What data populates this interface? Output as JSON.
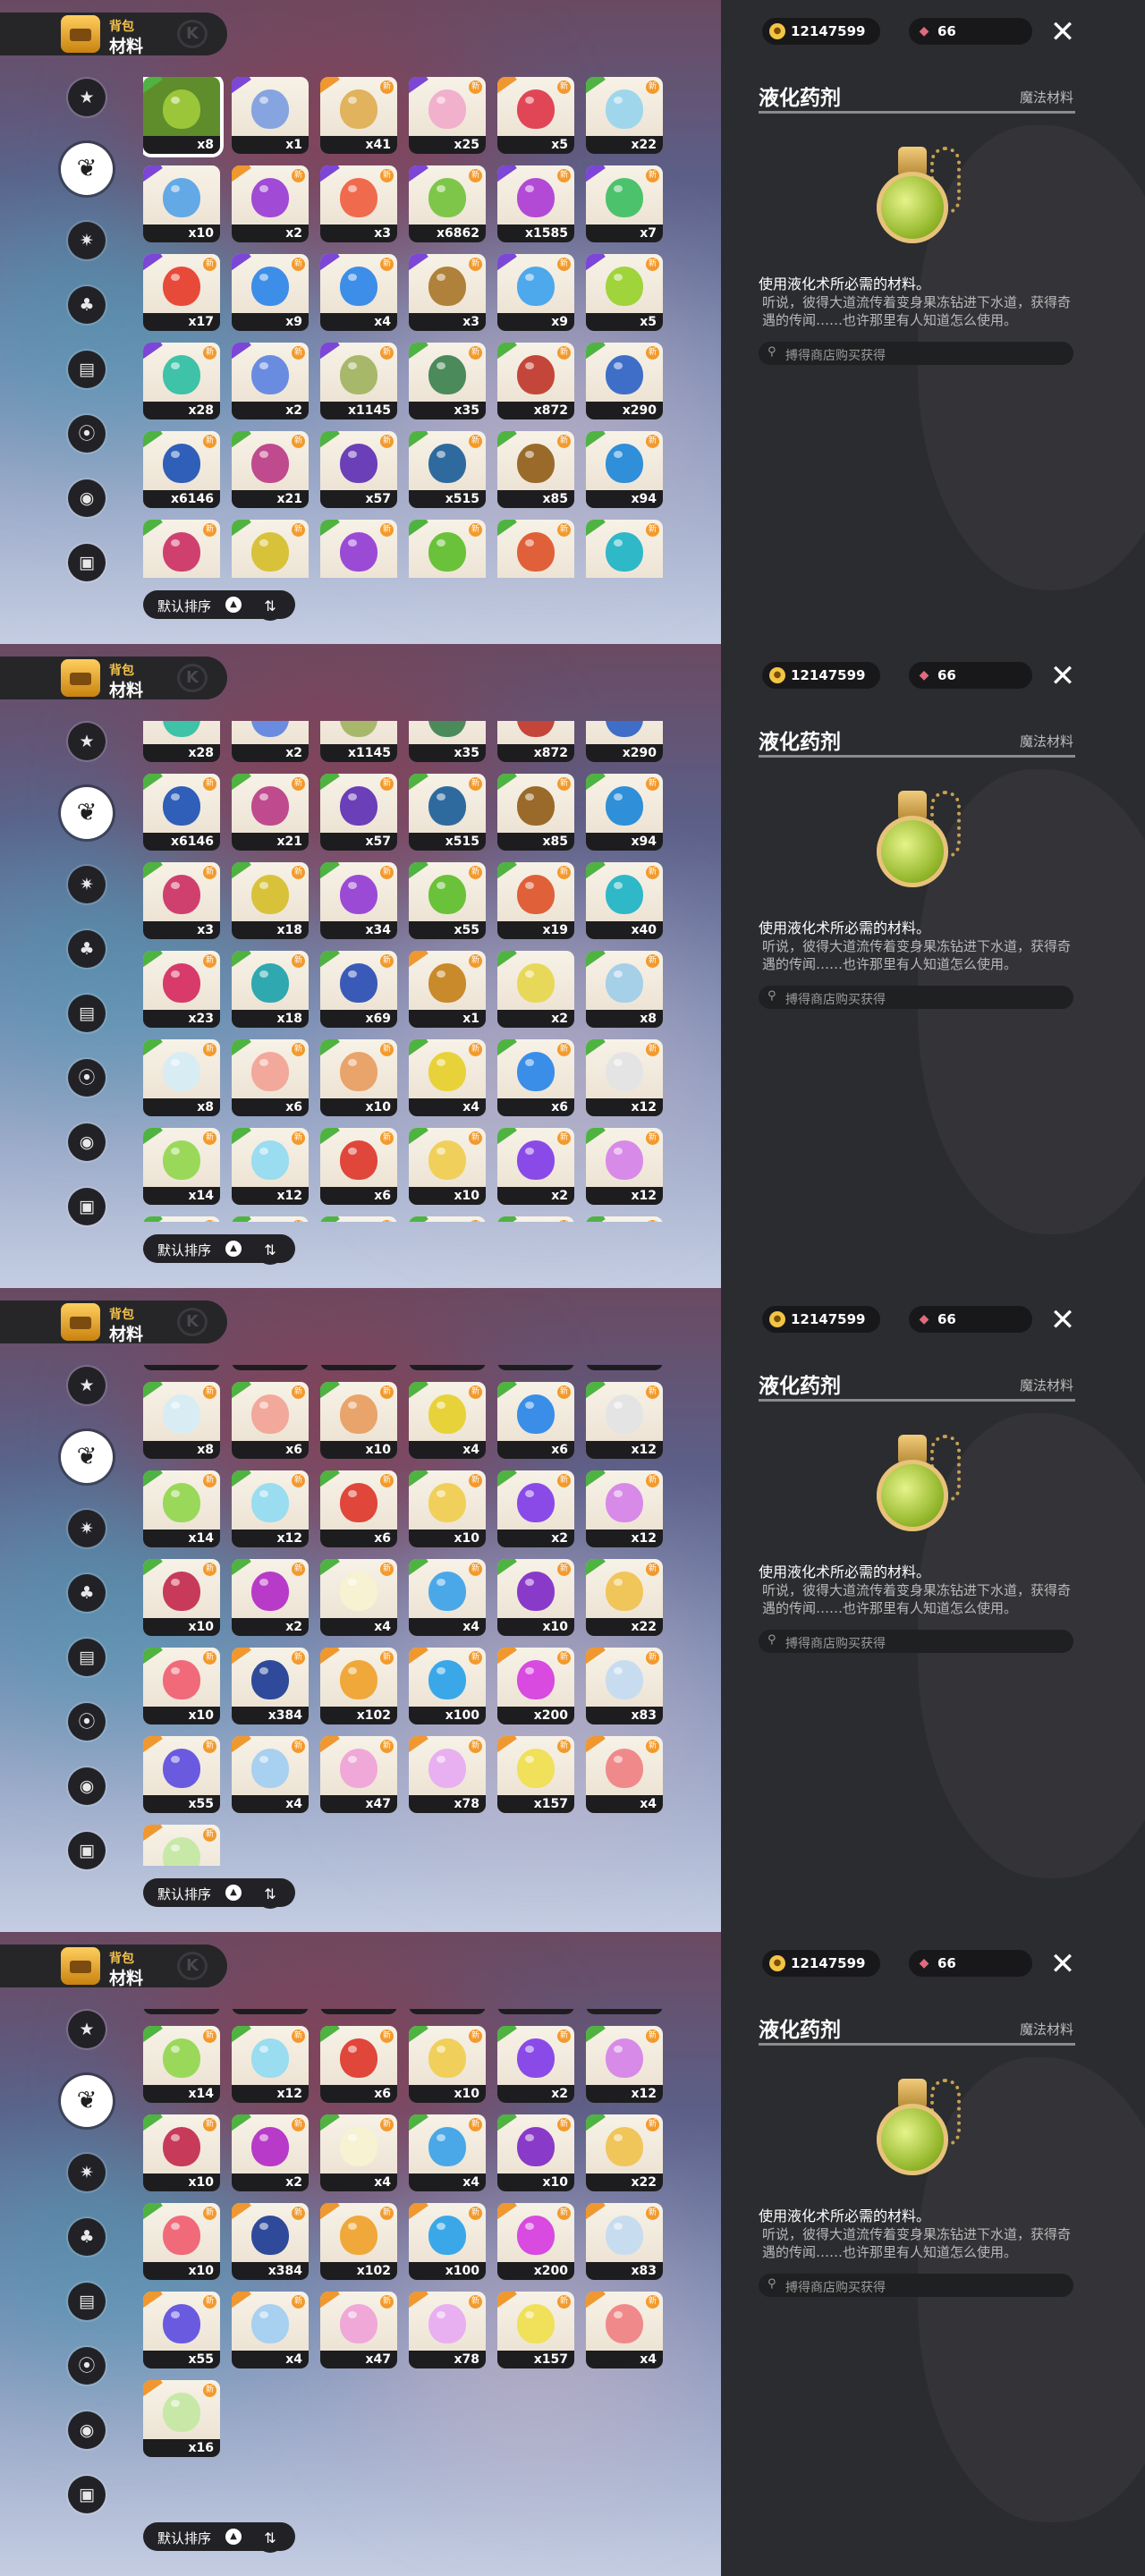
{
  "header": {
    "sub": "背包",
    "title": "材料",
    "icon": "backpack-icon"
  },
  "sidebar": {
    "items": [
      {
        "name": "star-category",
        "icon": "★"
      },
      {
        "name": "leaf-category",
        "icon": "❦",
        "active": true
      },
      {
        "name": "gear-category",
        "icon": "✷"
      },
      {
        "name": "tree-category",
        "icon": "♣"
      },
      {
        "name": "basket-category",
        "icon": "▤"
      },
      {
        "name": "swirl-category",
        "icon": "⦿"
      },
      {
        "name": "acorn-category",
        "icon": "◉"
      },
      {
        "name": "chest-category",
        "icon": "▣"
      }
    ]
  },
  "sort": {
    "label": "默认排序",
    "tri": "▲",
    "toggle": "⇅"
  },
  "currency": {
    "coins": "12147599",
    "gems": "66"
  },
  "detail": {
    "name": "液化药剂",
    "category": "魔法材料",
    "desc_title": "使用液化术所必需的材料。",
    "desc_body": "听说，彼得大道流传着变身果冻钻进下水道，获得奇遇的传闻……也许那里有人知道怎么使用。",
    "source": "搏得商店购买获得"
  },
  "items": [
    {
      "qty": "x8",
      "c": "#9bc63a",
      "f": "green",
      "sel": true
    },
    {
      "qty": "x1",
      "c": "#86a4e0",
      "f": "purple"
    },
    {
      "qty": "x41",
      "c": "#e0b35c",
      "f": "orange",
      "n": true
    },
    {
      "qty": "x25",
      "c": "#f1b0cc",
      "f": "purple",
      "n": true
    },
    {
      "qty": "x5",
      "c": "#e04656",
      "f": "orange",
      "n": true
    },
    {
      "qty": "x22",
      "c": "#9fd6ec",
      "f": "green",
      "n": true
    },
    {
      "qty": "x10",
      "c": "#62a9e6",
      "f": "purple"
    },
    {
      "qty": "x2",
      "c": "#a14ad6",
      "f": "orange",
      "n": true
    },
    {
      "qty": "x3",
      "c": "#f06a4e",
      "f": "purple",
      "n": true
    },
    {
      "qty": "x6862",
      "c": "#7ec64a",
      "f": "purple",
      "n": true
    },
    {
      "qty": "x1585",
      "c": "#b24ad6",
      "f": "purple",
      "n": true
    },
    {
      "qty": "x7",
      "c": "#4cc26c",
      "f": "purple",
      "n": true
    },
    {
      "qty": "x17",
      "c": "#e84a3a",
      "f": "purple",
      "n": true
    },
    {
      "qty": "x9",
      "c": "#3d8ee8",
      "f": "purple",
      "n": true
    },
    {
      "qty": "x4",
      "c": "#3d8ee8",
      "f": "purple",
      "n": true
    },
    {
      "qty": "x3",
      "c": "#b0813a",
      "f": "purple",
      "n": true
    },
    {
      "qty": "x9",
      "c": "#4ea8ec",
      "f": "purple",
      "n": true
    },
    {
      "qty": "x5",
      "c": "#9fd43a",
      "f": "purple",
      "n": true
    },
    {
      "qty": "x28",
      "c": "#3ec2a8",
      "f": "purple",
      "n": true
    },
    {
      "qty": "x2",
      "c": "#6a8ce0",
      "f": "purple",
      "n": true
    },
    {
      "qty": "x1145",
      "c": "#a8b86a",
      "f": "purple",
      "n": true
    },
    {
      "qty": "x35",
      "c": "#4b8a5a",
      "f": "green",
      "n": true
    },
    {
      "qty": "x872",
      "c": "#c4463a",
      "f": "green",
      "n": true
    },
    {
      "qty": "x290",
      "c": "#3f6ec8",
      "f": "green",
      "n": true
    },
    {
      "qty": "x6146",
      "c": "#2f5fb8",
      "f": "green",
      "n": true
    },
    {
      "qty": "x21",
      "c": "#c04a8e",
      "f": "green",
      "n": true
    },
    {
      "qty": "x57",
      "c": "#6a3fb8",
      "f": "green",
      "n": true
    },
    {
      "qty": "x515",
      "c": "#2f6a9e",
      "f": "green",
      "n": true
    },
    {
      "qty": "x85",
      "c": "#9a6a2a",
      "f": "green",
      "n": true
    },
    {
      "qty": "x94",
      "c": "#2f8fd8",
      "f": "green",
      "n": true
    },
    {
      "qty": "x3",
      "c": "#d0406e",
      "f": "green",
      "n": true
    },
    {
      "qty": "x18",
      "c": "#d8c23a",
      "f": "green",
      "n": true
    },
    {
      "qty": "x34",
      "c": "#9b4ad6",
      "f": "green",
      "n": true
    },
    {
      "qty": "x55",
      "c": "#6ac23a",
      "f": "green",
      "n": true
    },
    {
      "qty": "x19",
      "c": "#e0603a",
      "f": "green",
      "n": true
    },
    {
      "qty": "x40",
      "c": "#2fb8c8",
      "f": "green",
      "n": true
    },
    {
      "qty": "x23",
      "c": "#d83a6a",
      "f": "green",
      "n": true
    },
    {
      "qty": "x18",
      "c": "#2fa8b0",
      "f": "green",
      "n": true
    },
    {
      "qty": "x69",
      "c": "#3a5ab8",
      "f": "green",
      "n": true
    },
    {
      "qty": "x1",
      "c": "#c88a2a",
      "f": "orange",
      "n": true
    },
    {
      "qty": "x2",
      "c": "#e8d85a",
      "f": "green"
    },
    {
      "qty": "x8",
      "c": "#a6cfe8",
      "f": "green",
      "n": true
    },
    {
      "qty": "x8",
      "c": "#d8ecf4",
      "f": "green",
      "n": true
    },
    {
      "qty": "x6",
      "c": "#f2a89a",
      "f": "green",
      "n": true
    },
    {
      "qty": "x10",
      "c": "#e8a46a",
      "f": "green",
      "n": true
    },
    {
      "qty": "x4",
      "c": "#e8d23a",
      "f": "green",
      "n": true
    },
    {
      "qty": "x6",
      "c": "#3a8ee8",
      "f": "green",
      "n": true
    },
    {
      "qty": "x12",
      "c": "#e4e4e4",
      "f": "green",
      "n": true
    },
    {
      "qty": "x14",
      "c": "#9ad85a",
      "f": "green",
      "n": true
    },
    {
      "qty": "x12",
      "c": "#9adcf0",
      "f": "green",
      "n": true
    },
    {
      "qty": "x6",
      "c": "#e0463a",
      "f": "green",
      "n": true
    },
    {
      "qty": "x10",
      "c": "#f0d05a",
      "f": "green",
      "n": true
    },
    {
      "qty": "x2",
      "c": "#8a4ae8",
      "f": "green",
      "n": true
    },
    {
      "qty": "x12",
      "c": "#d88ae8",
      "f": "green",
      "n": true
    },
    {
      "qty": "x10",
      "c": "#c83a5a",
      "f": "green",
      "n": true
    },
    {
      "qty": "x2",
      "c": "#b83ac8",
      "f": "green",
      "n": true
    },
    {
      "qty": "x4",
      "c": "#f6f2d2",
      "f": "green",
      "n": true
    },
    {
      "qty": "x4",
      "c": "#4aa8e8",
      "f": "green",
      "n": true
    },
    {
      "qty": "x10",
      "c": "#8a3ac8",
      "f": "green",
      "n": true
    },
    {
      "qty": "x22",
      "c": "#f0c65a",
      "f": "green",
      "n": true
    },
    {
      "qty": "x10",
      "c": "#f06a7a",
      "f": "green",
      "n": true
    },
    {
      "qty": "x384",
      "c": "#2f4a9a",
      "f": "orange",
      "n": true
    },
    {
      "qty": "x102",
      "c": "#f0a83a",
      "f": "orange",
      "n": true
    },
    {
      "qty": "x100",
      "c": "#3aa8e8",
      "f": "orange",
      "n": true
    },
    {
      "qty": "x200",
      "c": "#d84ae0",
      "f": "orange",
      "n": true
    },
    {
      "qty": "x83",
      "c": "#c8dcf0",
      "f": "orange",
      "n": true
    },
    {
      "qty": "x55",
      "c": "#6a5ae0",
      "f": "orange",
      "n": true
    },
    {
      "qty": "x4",
      "c": "#a8d0f0",
      "f": "orange",
      "n": true
    },
    {
      "qty": "x47",
      "c": "#f0a8d8",
      "f": "orange",
      "n": true
    },
    {
      "qty": "x78",
      "c": "#e8b0f0",
      "f": "orange",
      "n": true
    },
    {
      "qty": "x157",
      "c": "#f0e05a",
      "f": "orange",
      "n": true
    },
    {
      "qty": "x4",
      "c": "#f08a8a",
      "f": "orange",
      "n": true
    },
    {
      "qty": "x16",
      "c": "#c8e8a8",
      "f": "orange",
      "n": true
    }
  ],
  "panels": [
    {
      "name": "panel-1",
      "first_row": 0,
      "offset": 0
    },
    {
      "name": "panel-2",
      "first_row": 3,
      "offset": -40
    },
    {
      "name": "panel-3",
      "first_row": 6,
      "offset": -80
    },
    {
      "name": "panel-4",
      "first_row": 7,
      "offset": -80
    }
  ]
}
